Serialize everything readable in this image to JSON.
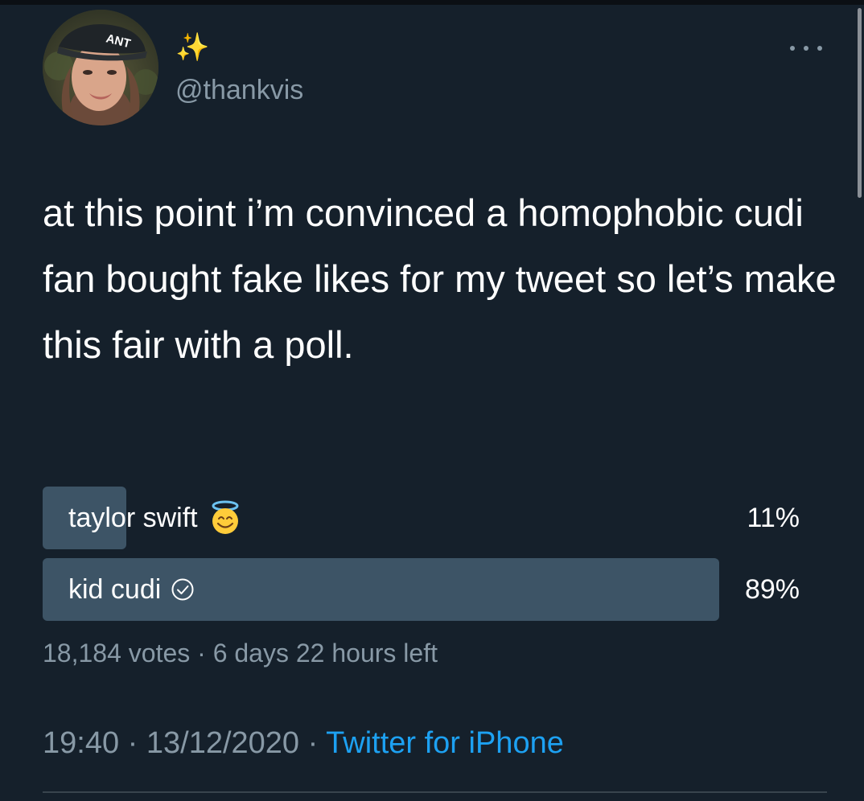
{
  "user": {
    "display_name": "✨",
    "handle": "@thankvis",
    "cap_text": "ANT"
  },
  "tweet": {
    "text": "at this point i’m convinced a homophobic cudi fan bought fake likes for my tweet so let’s make this fair with a poll."
  },
  "poll": {
    "options": [
      {
        "label": "taylor swift",
        "percent_label": "11%",
        "fill_fraction": 0.11,
        "icon": "smiling-face-with-halo-icon",
        "winner": false
      },
      {
        "label": "kid cudi",
        "percent_label": "89%",
        "fill_fraction": 0.89,
        "icon": "check-circle-icon",
        "winner": true
      }
    ],
    "votes": "18,184 votes",
    "separator": "·",
    "time_left": "6 days 22 hours left"
  },
  "meta": {
    "time": "19:40",
    "separator": "·",
    "date": "13/12/2020",
    "source": "Twitter for iPhone"
  },
  "colors": {
    "background": "#15202b",
    "text_primary": "#ffffff",
    "text_secondary": "#8899a6",
    "link": "#1da1f2",
    "poll_bar": "#3d5466",
    "divider": "#38444d"
  }
}
